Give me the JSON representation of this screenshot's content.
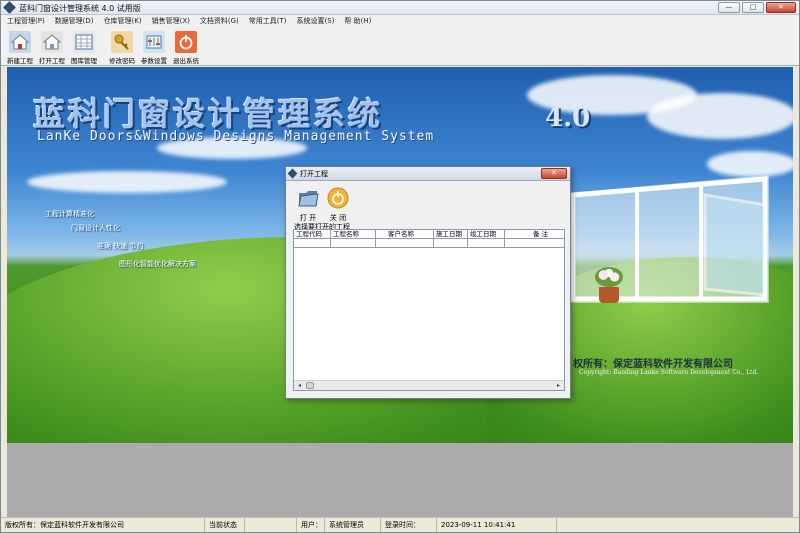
{
  "window": {
    "title": "蓝科门窗设计管理系统 4.0 试用版",
    "min": "—",
    "max": "□",
    "close": "✕"
  },
  "menu": [
    "工程管理(P)",
    "数据管理(D)",
    "仓库管理(K)",
    "销售管理(X)",
    "文档资料(G)",
    "常用工具(T)",
    "系统设置(S)",
    "帮 助(H)"
  ],
  "toolbar": [
    {
      "label": "新建工程",
      "icon": "new-project-icon",
      "color": "#c8d7e8"
    },
    {
      "label": "打开工程",
      "icon": "open-project-icon",
      "color": "#e3e3e3"
    },
    {
      "label": "图库管理",
      "icon": "gallery-icon",
      "color": "#dfe8f2"
    },
    {
      "label": "修改密码",
      "icon": "key-icon",
      "color": "#eed9a4"
    },
    {
      "label": "参数设置",
      "icon": "settings-icon",
      "color": "#cfe3f0"
    },
    {
      "label": "退出系统",
      "icon": "exit-icon",
      "color": "#e76a3d"
    }
  ],
  "banner": {
    "title_cn": "蓝科门窗设计管理系统",
    "version": "4.0",
    "title_en": "LanKe Doors&Windows Designs Management System",
    "features": [
      "工程计算精准化",
      "门窗设计人性化",
      "准确 快速 节约",
      "图形化智能优化解决方案"
    ],
    "copyright_cn": "权所有：保定蓝科软件开发有限公司",
    "copyright_en": "Copyright: Baoding Lanke Software Development Co., Ltd."
  },
  "dialog": {
    "title": "打开工程",
    "close": "✕",
    "open_label": "打 开",
    "close_label": "关 闭",
    "caption": "选择要打开的工程",
    "columns": [
      "工程代码",
      "工程名称",
      "客户名称",
      "施工日期",
      "竣工日期",
      "备 注"
    ],
    "scroll_left": "◂",
    "scroll_right": "▸"
  },
  "status": {
    "copyright": "版权所有：保定蓝科软件开发有限公司",
    "state_label": "当前状态",
    "user_label": "用户：",
    "user": "系统管理员",
    "login_label": "登录时间：",
    "login_time": "2023-09-11 10:41:41"
  },
  "colors": {
    "sky": "#3f86d2",
    "grass": "#3a8a1e",
    "accent": "#c7432e"
  }
}
